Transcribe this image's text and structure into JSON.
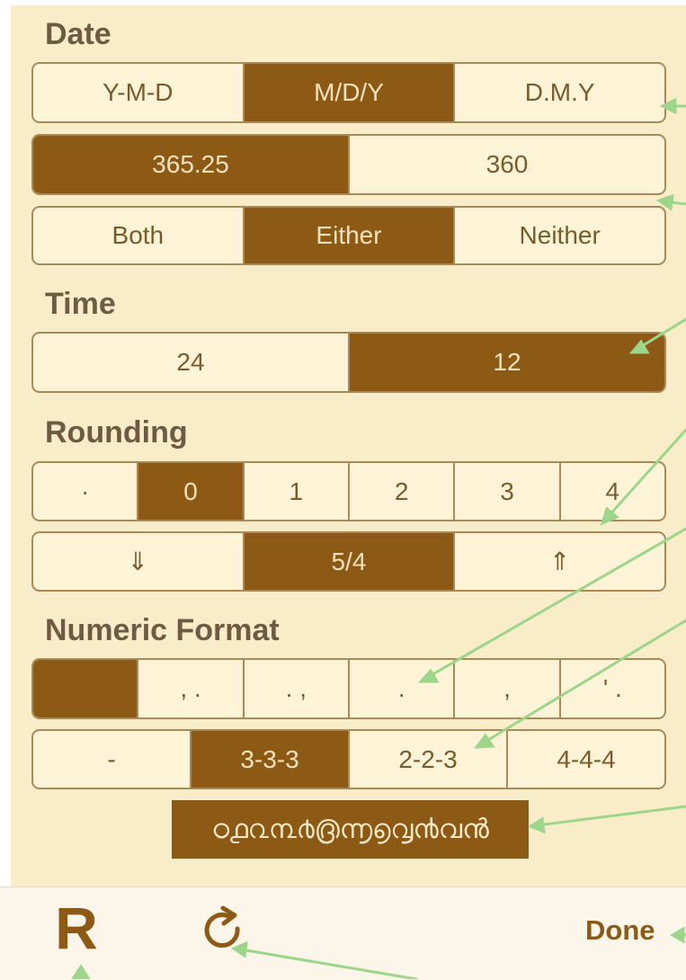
{
  "sections": {
    "date": "Date",
    "time": "Time",
    "rounding": "Rounding",
    "numeric_format": "Numeric Format"
  },
  "date_order": {
    "options": [
      "Y-M-D",
      "M/D/Y",
      "D.M.Y"
    ],
    "selected": "M/D/Y"
  },
  "year_length": {
    "options": [
      "365.25",
      "360"
    ],
    "selected": "365.25"
  },
  "date_inclusion": {
    "options": [
      "Both",
      "Either",
      "Neither"
    ],
    "selected": "Either"
  },
  "time_format": {
    "options": [
      "24",
      "12"
    ],
    "selected": "12"
  },
  "rounding_digits": {
    "options": [
      "·",
      "0",
      "1",
      "2",
      "3",
      "4"
    ],
    "selected": "0"
  },
  "rounding_mode": {
    "options": [
      "⇓",
      "5/4",
      "⇑"
    ],
    "selected": "5/4"
  },
  "number_separators": {
    "options": [
      "",
      ", .",
      ". ,",
      ".",
      ",",
      "' ."
    ],
    "selected_index": 0
  },
  "digit_grouping": {
    "options": [
      "-",
      "3-3-3",
      "2-2-3",
      "4-4-4"
    ],
    "selected": "3-3-3"
  },
  "language_button": "ഠ൧൨൩൪൫൬൭൮൯വൻ",
  "toolbar": {
    "r_label": "R",
    "done_label": "Done",
    "refresh_icon": "refresh-icon"
  },
  "colors": {
    "background": "#f9ecc8",
    "accent": "#8c5a15",
    "text": "#6f5b43",
    "annotation_arrow": "#9dd58a"
  }
}
